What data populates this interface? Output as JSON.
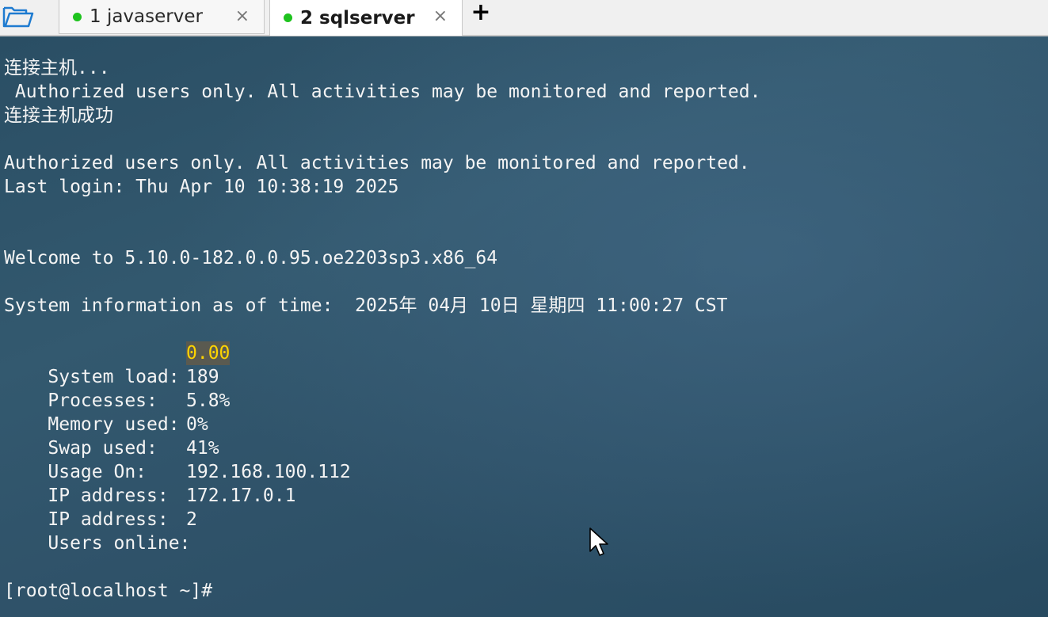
{
  "tabs": [
    {
      "label": "1 javaserver",
      "active": false,
      "status_color": "#1ec31e"
    },
    {
      "label": "2 sqlserver",
      "active": true,
      "status_color": "#1ec31e"
    }
  ],
  "toolbar": {
    "folder_icon": "folder-open-icon",
    "close_symbol": "×",
    "add_symbol": "+"
  },
  "terminal": {
    "connecting": "连接主机...",
    "banner1": " Authorized users only. All activities may be monitored and reported.",
    "connected": "连接主机成功",
    "banner2": "Authorized users only. All activities may be monitored and reported.",
    "last_login": "Last login: Thu Apr 10 10:38:19 2025",
    "welcome": "Welcome to 5.10.0-182.0.0.95.oe2203sp3.x86_64",
    "sysinfo": "System information as of time:  2025年 04月 10日 星期四 11:00:27 CST",
    "stats": [
      {
        "label": "System load:",
        "value": "0.00"
      },
      {
        "label": "Processes:",
        "value": "189"
      },
      {
        "label": "Memory used:",
        "value": "5.8%"
      },
      {
        "label": "Swap used:",
        "value": "0%"
      },
      {
        "label": "Usage On:",
        "value": "41%"
      },
      {
        "label": "IP address:",
        "value": "192.168.100.112"
      },
      {
        "label": "IP address:",
        "value": "172.17.0.1"
      },
      {
        "label": "Users online:",
        "value": "2"
      }
    ],
    "prompt": "[root@localhost ~]#",
    "highlight_color": "#ffd400"
  }
}
